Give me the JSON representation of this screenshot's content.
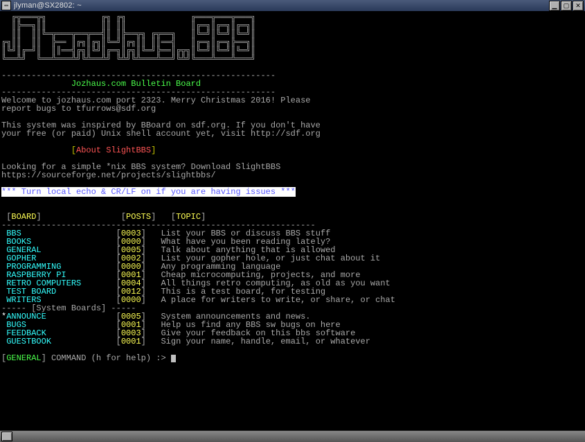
{
  "window": {
    "title": "jlyman@SX2802: ~"
  },
  "ascii_art": [
    "  ╔╦═══╦╗           ╔╗ ╔╗             ╔═══╦═══╦═══╗",
    "  ║╠══╗║║           ║║ ║║             ║╔═╗║╔═╗║╔═╗║",
    "  ║║  ║║╚═╦═══╦══╦══╣║ ║╠══╦╗ ╔╦══╗   ║╚═╝║╚═╝║╚═╝║",
    "╔╗║║  ║║  ╠══ ║╔╗║╔╗║╚═╝║╔╗║║ ║║══╣   ║╔═╗║╔═╗╠══╗║",
    "║╚╝║╔═╝║  ║║══╣╔╗║╚╝║╔═╗║╔╗║╚═╝╠══║╔╦╗║╚═╝║╚═╝║╚═╝║",
    "╚══╩╝  ╚══╩═══╩╝╚╩══╩╝ ╚╩╝╚╩═══╩══╝╚╩╝╚═══╩═══╩═══╝"
  ],
  "divider": "-------------------------------------------------------",
  "banner": "Jozhaus.com Bulletin Board",
  "welcome": {
    "line1": "Welcome to jozhaus.com port 2323. Merry Christmas 2016! Please",
    "line2": "report bugs to tfurrows@sdf.org"
  },
  "inspired": {
    "line1": "This system was inspired by BBoard on sdf.org. If you don't have",
    "line2": "your free (or paid) Unix shell account yet, visit http://sdf.org"
  },
  "about_heading": "About SlightBBS",
  "slightbbs": {
    "line1": "Looking for a simple *nix BBS system? Download SlightBBS",
    "line2": "https://sourceforge.net/projects/slightbbs/"
  },
  "notice": "*** Turn local echo & CR/LF on if you are having issues ***",
  "headers": {
    "board": "BOARD",
    "posts": "POSTS",
    "topic": "TOPIC"
  },
  "row_divider": "---------------------------------------------------------------",
  "boards": [
    {
      "name": "BBS",
      "posts": "0003",
      "topic": "List your BBS or discuss BBS stuff"
    },
    {
      "name": "BOOKS",
      "posts": "0000",
      "topic": "What have you been reading lately?"
    },
    {
      "name": "GENERAL",
      "posts": "0005",
      "topic": "Talk about anything that is allowed"
    },
    {
      "name": "GOPHER",
      "posts": "0002",
      "topic": "List your gopher hole, or just chat about it"
    },
    {
      "name": "PROGRAMMING",
      "posts": "0000",
      "topic": "Any programming language"
    },
    {
      "name": "RASPBERRY PI",
      "posts": "0001",
      "topic": "Cheap microcomputing, projects, and more"
    },
    {
      "name": "RETRO COMPUTERS",
      "posts": "0004",
      "topic": "All things retro computing, as old as you want"
    },
    {
      "name": "TEST BOARD",
      "posts": "0012",
      "topic": "This is a test board, for testing"
    },
    {
      "name": "WRITERS",
      "posts": "0000",
      "topic": "A place for writers to write, or share, or chat"
    }
  ],
  "system_section": "----- [System Boards] -----",
  "system_boards": [
    {
      "star": true,
      "name": "ANNOUNCE",
      "posts": "0005",
      "topic": "System announcements and news."
    },
    {
      "star": false,
      "name": "BUGS",
      "posts": "0001",
      "topic": "Help us find any BBS sw bugs on here"
    },
    {
      "star": false,
      "name": "FEEDBACK",
      "posts": "0003",
      "topic": "Give your feedback on this bbs software"
    },
    {
      "star": false,
      "name": "GUESTBOOK",
      "posts": "0001",
      "topic": "Sign your name, handle, email, or whatever"
    }
  ],
  "prompt": {
    "context": "GENERAL",
    "text": " COMMAND (h for help) :> "
  }
}
